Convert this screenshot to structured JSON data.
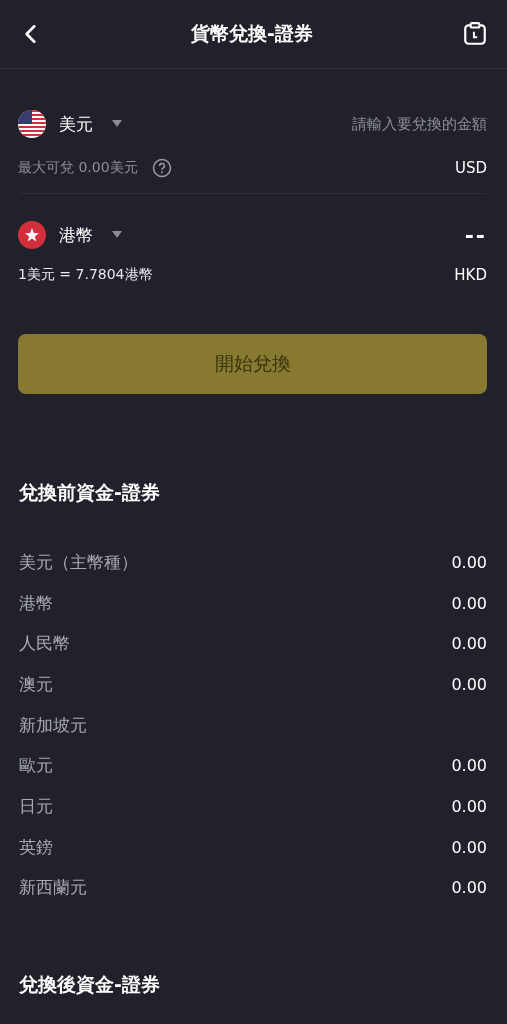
{
  "header": {
    "title": "貨幣兌換-證券"
  },
  "from": {
    "currency": "美元",
    "kind": "us",
    "placeholder": "請輸入要兌換的金額",
    "note": "最大可兌 0.00美元",
    "code": "USD"
  },
  "to": {
    "currency": "港幣",
    "kind": "hk",
    "amount": "--",
    "note": "1美元 = 7.7804港幣",
    "code": "HKD"
  },
  "button": {
    "label": "開始兌換",
    "disabled": true
  },
  "before": {
    "title": "兌換前資金-證券",
    "rows": [
      {
        "name": "美元（主幣種）",
        "value": "0.00"
      },
      {
        "name": "港幣",
        "value": "0.00"
      },
      {
        "name": "人民幣",
        "value": "0.00"
      },
      {
        "name": "澳元",
        "value": "0.00"
      },
      {
        "name": "新加坡元"
      },
      {
        "name": "歐元",
        "value": "0.00"
      },
      {
        "name": "日元",
        "value": "0.00"
      },
      {
        "name": "英鎊",
        "value": "0.00"
      },
      {
        "name": "新西蘭元",
        "value": "0.00"
      }
    ]
  },
  "after": {
    "title": "兌換後資金-證券"
  }
}
